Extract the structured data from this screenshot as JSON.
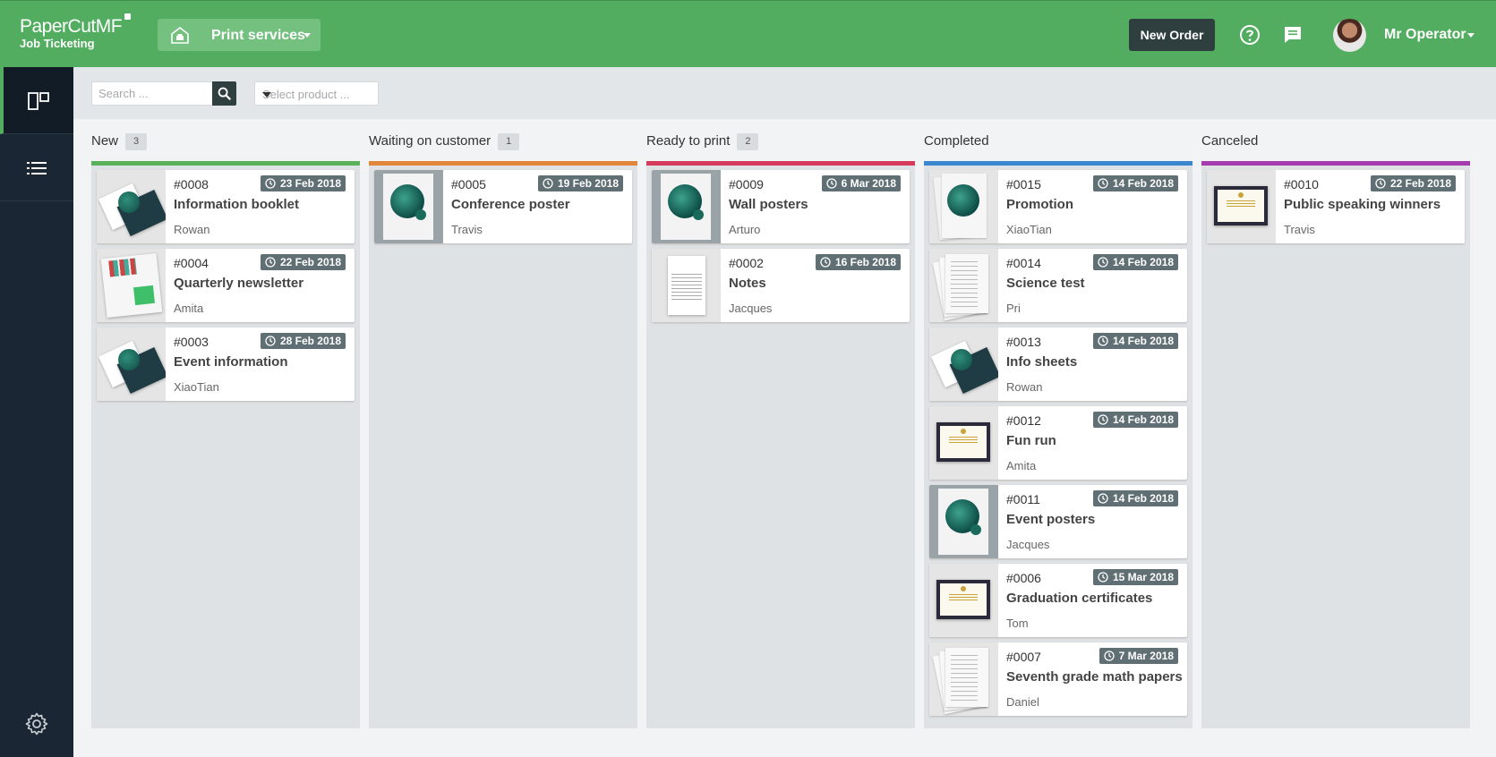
{
  "header": {
    "logo_line1": "PaperCut",
    "logo_line1b": "MF",
    "logo_line2": "Job Ticketing",
    "service_label": "Print services",
    "new_order_label": "New Order",
    "user_name": "Mr Operator"
  },
  "toolbar": {
    "search_placeholder": "Search ...",
    "product_placeholder": "Select product ..."
  },
  "colors": {
    "header_green": "#52ad60",
    "sidebar": "#1a2633",
    "col_new": "#59b259",
    "col_waiting": "#e0853a",
    "col_ready": "#d63b5e",
    "col_completed": "#3b87cf",
    "col_canceled": "#a53cad"
  },
  "columns": [
    {
      "title": "New",
      "count": "3",
      "cards": [
        {
          "num": "#0008",
          "date": "23 Feb 2018",
          "title": "Information booklet",
          "owner": "Rowan",
          "thumb": "booklet"
        },
        {
          "num": "#0004",
          "date": "22 Feb 2018",
          "title": "Quarterly newsletter",
          "owner": "Amita",
          "thumb": "newsletter"
        },
        {
          "num": "#0003",
          "date": "28 Feb 2018",
          "title": "Event information",
          "owner": "XiaoTian",
          "thumb": "booklet"
        }
      ]
    },
    {
      "title": "Waiting on customer",
      "count": "1",
      "cards": [
        {
          "num": "#0005",
          "date": "19 Feb 2018",
          "title": "Conference poster",
          "owner": "Travis",
          "thumb": "poster"
        }
      ]
    },
    {
      "title": "Ready to print",
      "count": "2",
      "cards": [
        {
          "num": "#0009",
          "date": "6 Mar 2018",
          "title": "Wall posters",
          "owner": "Arturo",
          "thumb": "poster"
        },
        {
          "num": "#0002",
          "date": "16 Feb 2018",
          "title": "Notes",
          "owner": "Jacques",
          "thumb": "document"
        }
      ]
    },
    {
      "title": "Completed",
      "count": "",
      "cards": [
        {
          "num": "#0015",
          "date": "14 Feb 2018",
          "title": "Promotion",
          "owner": "XiaoTian",
          "thumb": "promo"
        },
        {
          "num": "#0014",
          "date": "14 Feb 2018",
          "title": "Science test",
          "owner": "Pri",
          "thumb": "stack"
        },
        {
          "num": "#0013",
          "date": "14 Feb 2018",
          "title": "Info sheets",
          "owner": "Rowan",
          "thumb": "booklet"
        },
        {
          "num": "#0012",
          "date": "14 Feb 2018",
          "title": "Fun run",
          "owner": "Amita",
          "thumb": "certificate"
        },
        {
          "num": "#0011",
          "date": "14 Feb 2018",
          "title": "Event posters",
          "owner": "Jacques",
          "thumb": "poster"
        },
        {
          "num": "#0006",
          "date": "15 Mar 2018",
          "title": "Graduation certificates",
          "owner": "Tom",
          "thumb": "certificate"
        },
        {
          "num": "#0007",
          "date": "7 Mar 2018",
          "title": "Seventh grade math papers",
          "owner": "Daniel",
          "thumb": "stack"
        }
      ]
    },
    {
      "title": "Canceled",
      "count": "",
      "cards": [
        {
          "num": "#0010",
          "date": "22 Feb 2018",
          "title": "Public speaking winners",
          "owner": "Travis",
          "thumb": "certificate"
        }
      ]
    }
  ]
}
